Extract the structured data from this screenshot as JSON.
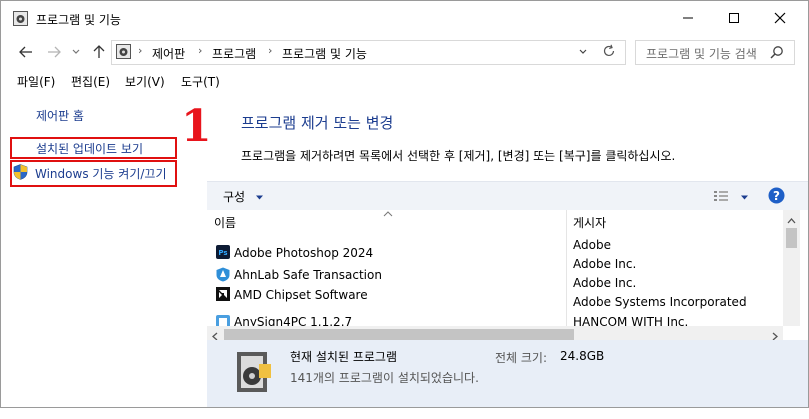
{
  "window": {
    "title": "프로그램 및 기능"
  },
  "address": {
    "crumbs": [
      "제어판",
      "프로그램",
      "프로그램 및 기능"
    ]
  },
  "search": {
    "placeholder": "프로그램 및 기능 검색"
  },
  "menu": {
    "items": [
      "파일(F)",
      "편집(E)",
      "보기(V)",
      "도구(T)"
    ]
  },
  "sidebar": {
    "home": "제어판 홈",
    "installed_updates": "설치된 업데이트 보기",
    "windows_features": "Windows 기능 켜기/끄기"
  },
  "annotation": {
    "step": "1",
    "color": "#e8141c"
  },
  "main": {
    "title": "프로그램 제거 또는 변경",
    "description": "프로그램을 제거하려면 목록에서 선택한 후 [제거], [변경] 또는 [복구]를 클릭하십시오."
  },
  "toolbar": {
    "organize": "구성"
  },
  "list": {
    "columns": [
      "이름",
      "게시자"
    ],
    "rows": [
      {
        "name": "Adobe Photoshop 2024",
        "publisher": "Adobe",
        "icon": "photoshop-icon"
      },
      {
        "name": "AhnLab Safe Transaction",
        "publisher": "Adobe Inc.",
        "icon": "ahnlab-icon"
      },
      {
        "name": "AMD Chipset Software",
        "publisher": "Adobe Inc.",
        "icon": "amd-icon"
      },
      {
        "name": "AnySign4PC 1.1.2.7",
        "publisher": "Adobe Systems Incorporated",
        "icon": "anysign-icon"
      },
      {
        "name": "",
        "publisher": "HANCOM WITH Inc.",
        "icon": ""
      }
    ]
  },
  "details": {
    "title": "현재 설치된 프로그램",
    "size_label": "전체 크기:",
    "size_value": "24.8GB",
    "count_text": "141개의 프로그램이 설치되었습니다."
  },
  "colors": {
    "link": "#1c3d8f",
    "highlight_box": "#e01010",
    "details_bg": "#e8eef7",
    "toolbar_bg": "#f0f3f8"
  }
}
